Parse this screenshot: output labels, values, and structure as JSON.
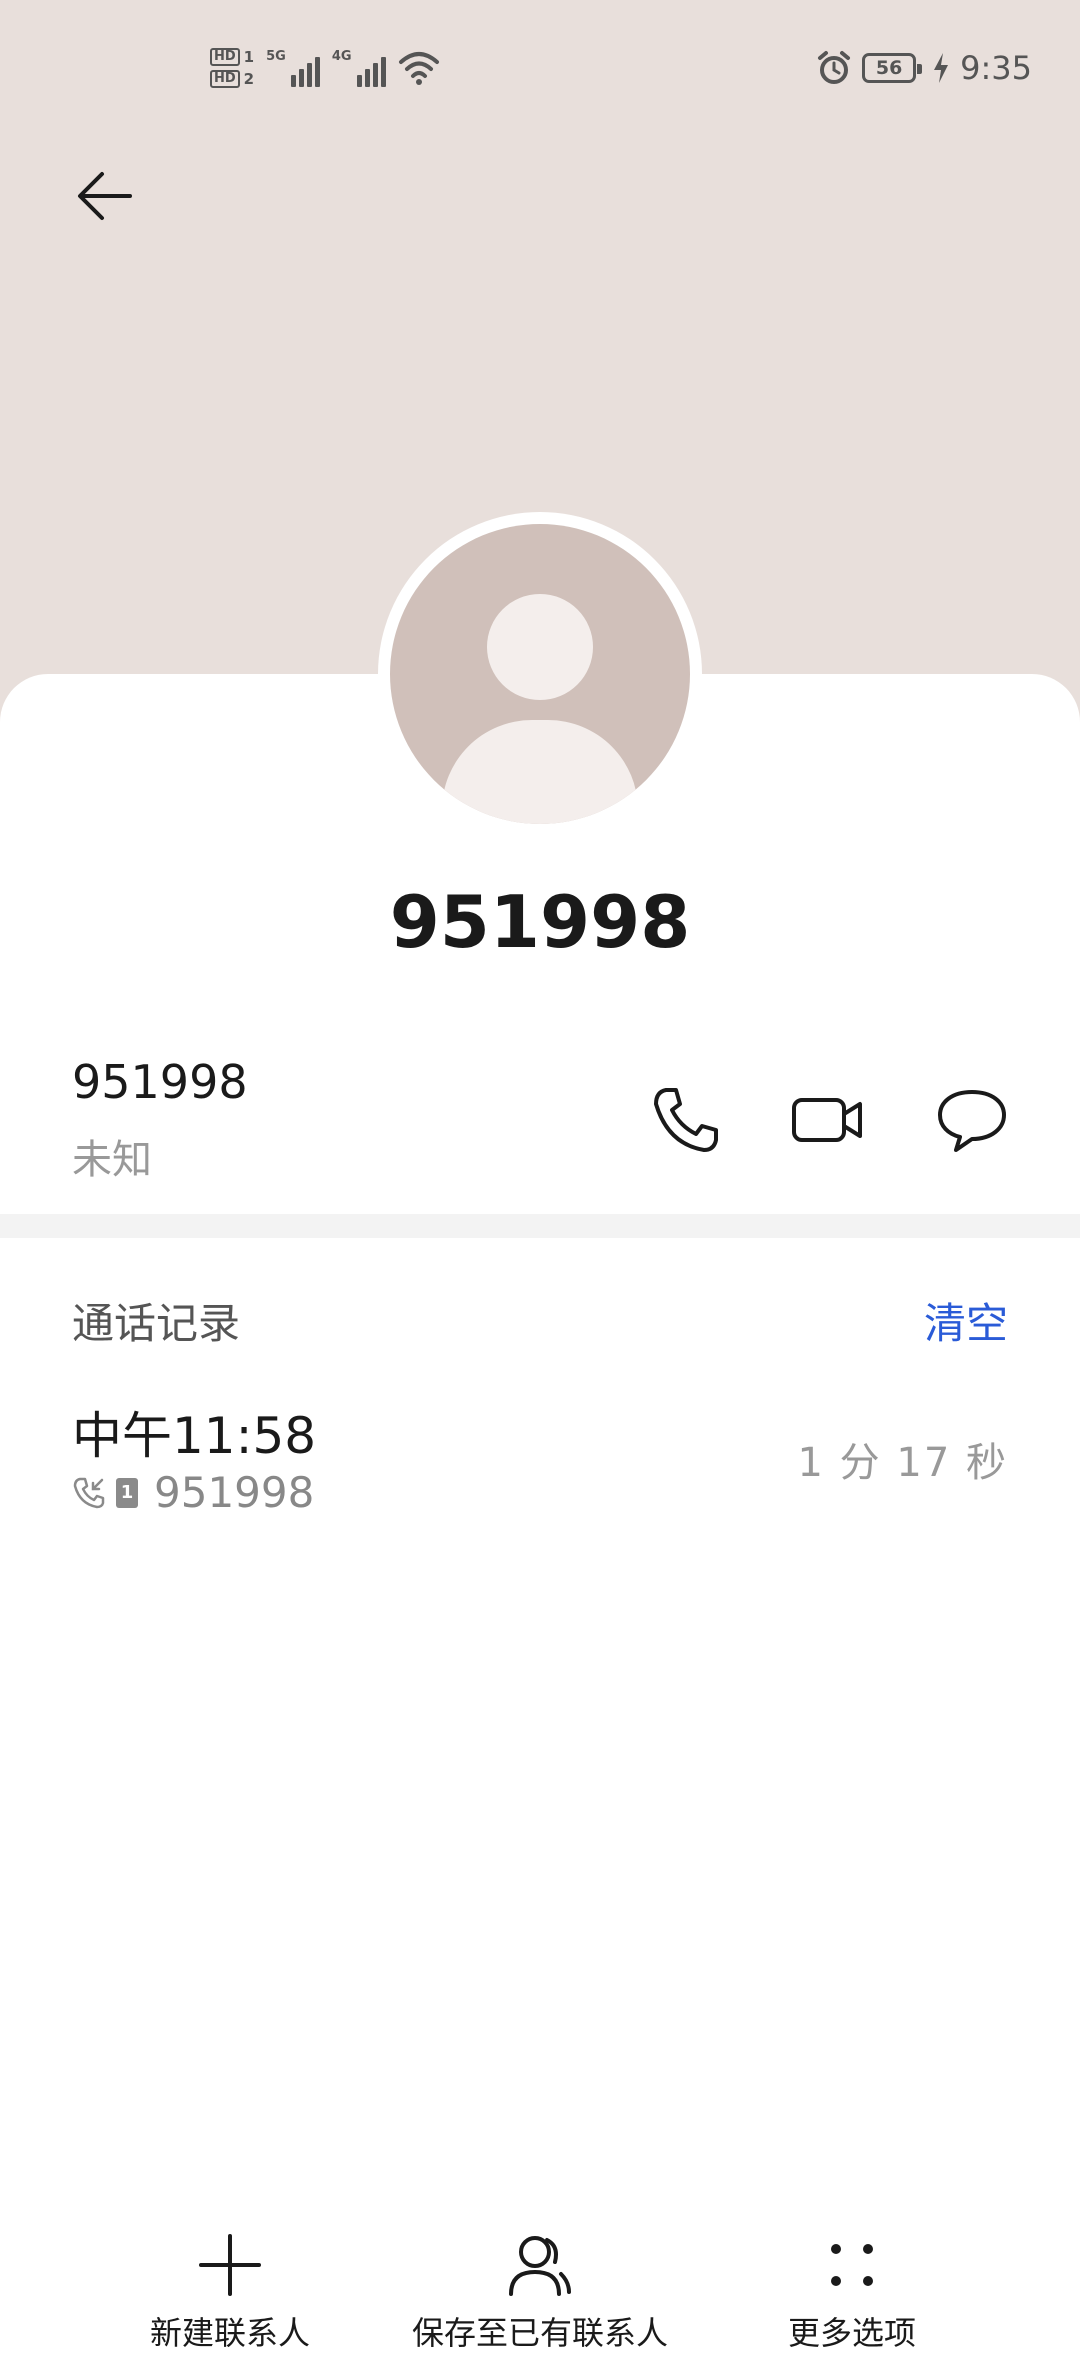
{
  "status_bar": {
    "hd1": "HD",
    "sim1": "1",
    "hd2": "HD",
    "sim2": "2",
    "net1": "5G",
    "net2": "4G",
    "battery": "56",
    "time": "9:35"
  },
  "contact": {
    "title": "951998"
  },
  "number_row": {
    "number": "951998",
    "type": "未知"
  },
  "call_log": {
    "title": "通话记录",
    "clear_label": "清空",
    "entries": [
      {
        "time": "中午11:58",
        "sim": "1",
        "number": "951998",
        "duration": "1 分 17 秒"
      }
    ]
  },
  "bottom_bar": {
    "new_contact": "新建联系人",
    "save_existing": "保存至已有联系人",
    "more": "更多选项"
  }
}
